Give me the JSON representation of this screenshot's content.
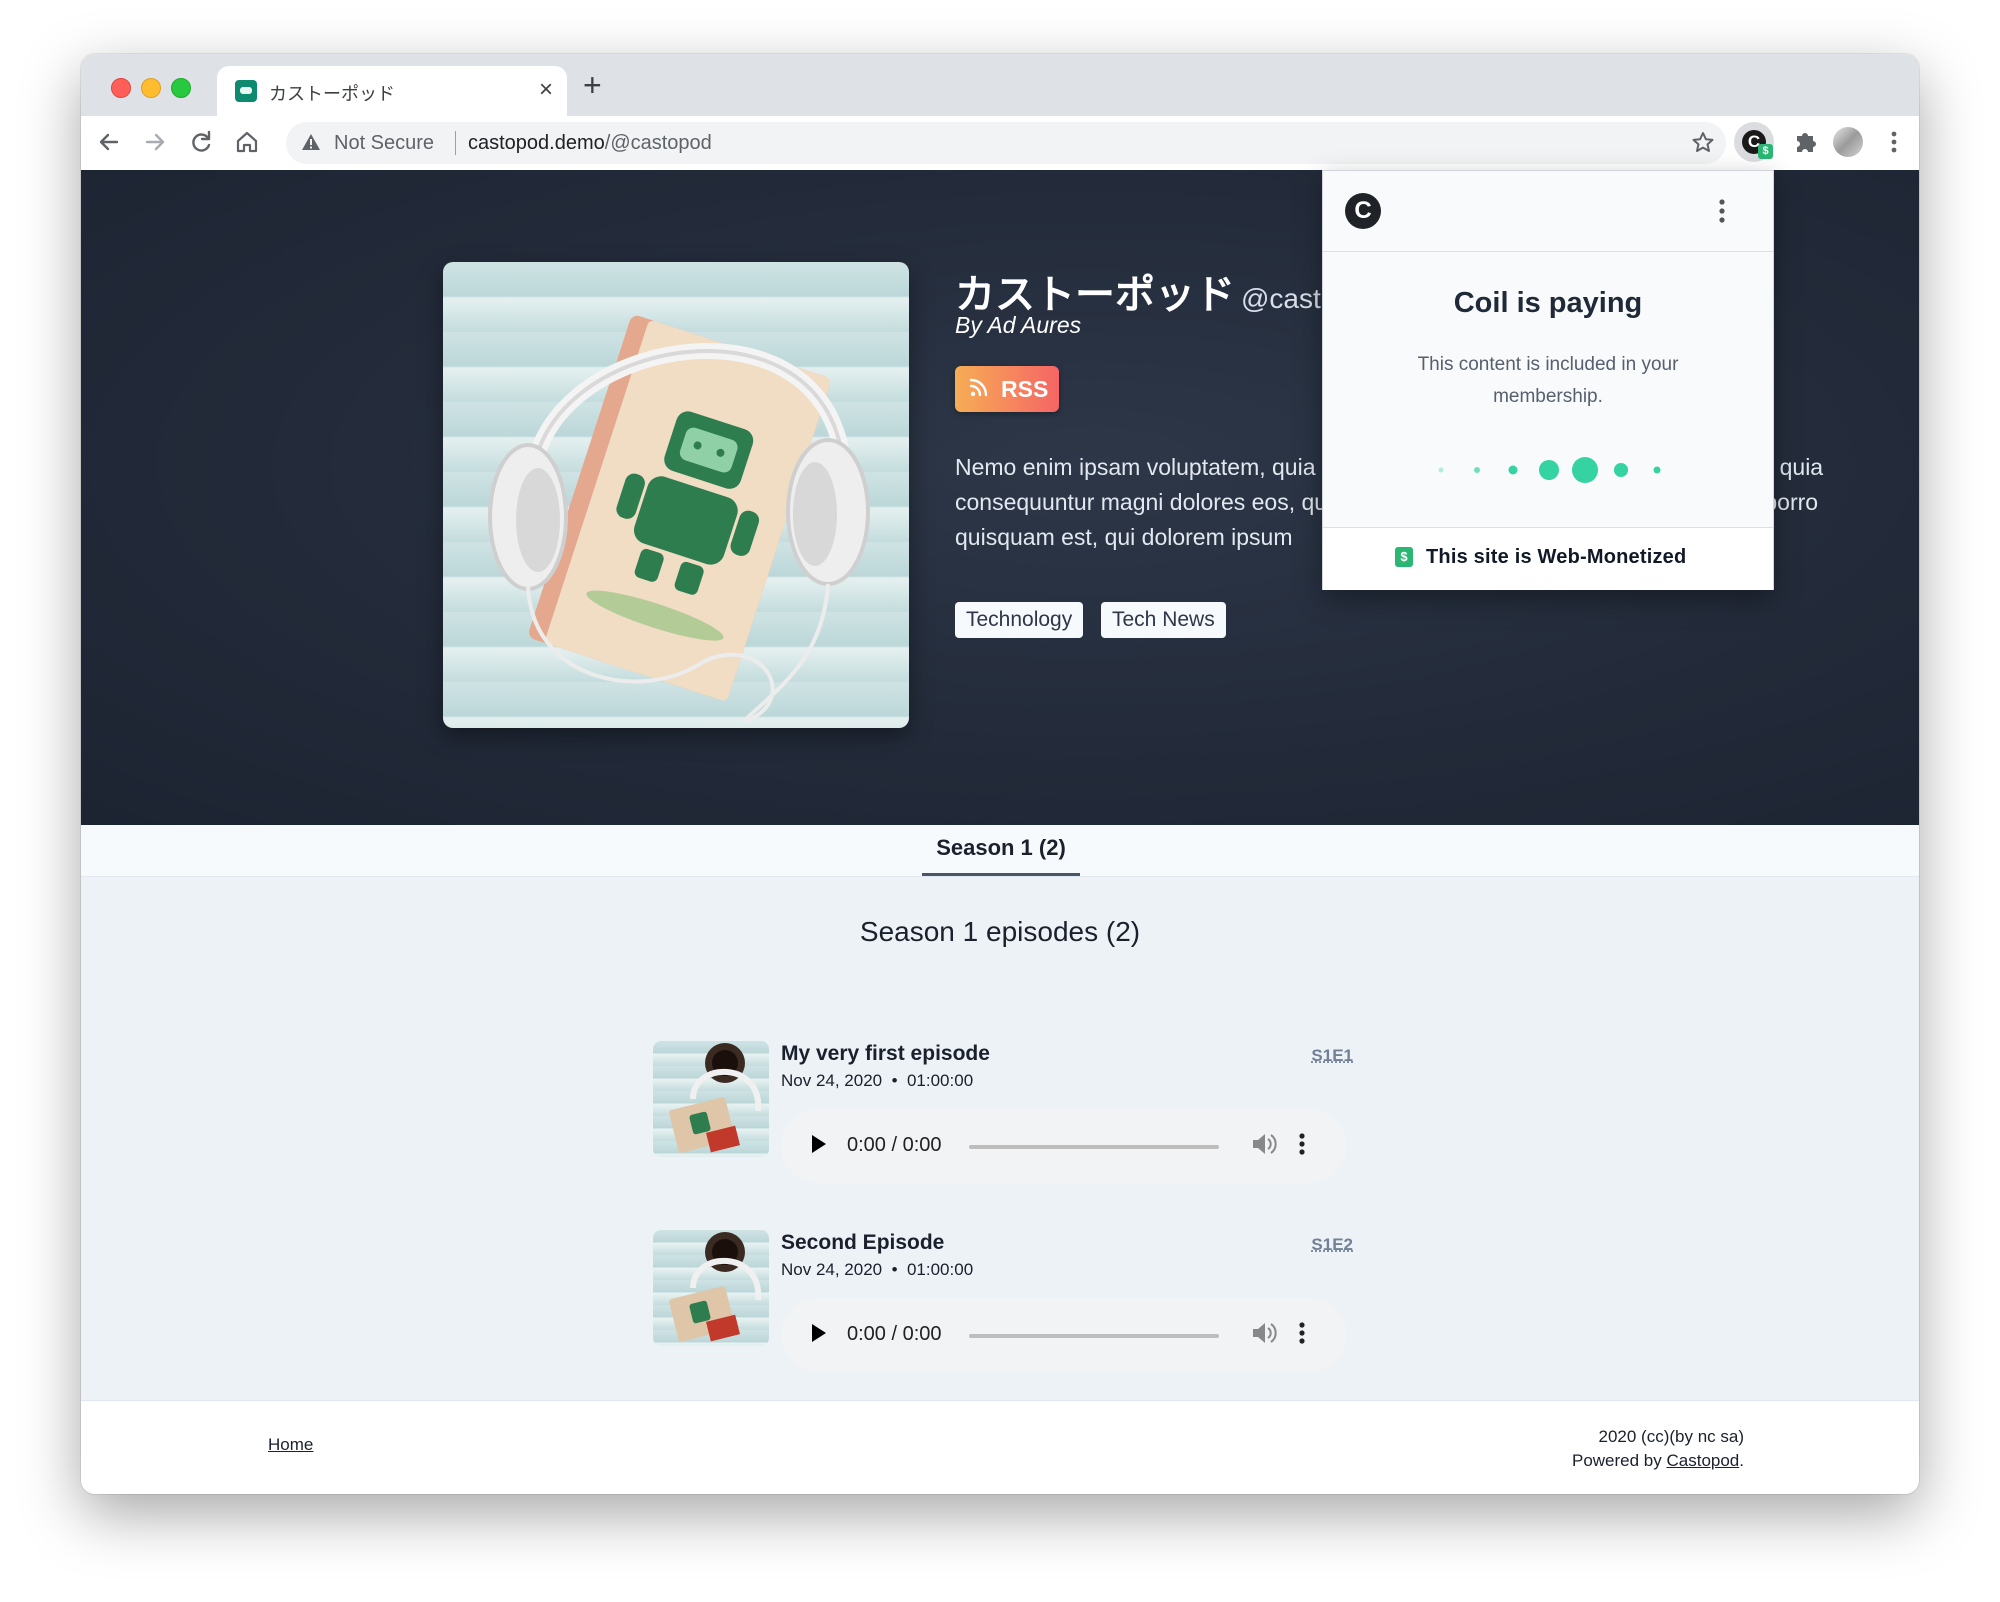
{
  "browser": {
    "tab_title": "カストーポッド",
    "tab_close": "×",
    "new_tab": "+",
    "omnibox": {
      "security_label": "Not Secure",
      "url_host": "castopod.demo",
      "url_path": "/@castopod"
    },
    "icons": [
      "back-icon",
      "forward-icon",
      "reload-icon",
      "home-icon",
      "warning-icon",
      "star-icon",
      "coil-extension-icon",
      "extensions-icon",
      "profile-avatar",
      "chrome-menu-icon"
    ]
  },
  "podcast": {
    "title": "カストーポッド",
    "handle": "@castopod",
    "author": "By Ad Aures",
    "rss_label": "RSS",
    "description": "Nemo enim ipsam voluptatem, quia voluptas sit aspernatur aut odit aut fugit, sed quia consequuntur magni dolores eos, qui ratione voluptatem sequi nesciunt, neque porro quisquam est, qui dolorem ipsum",
    "categories": [
      "Technology",
      "Tech News"
    ]
  },
  "coil_popup": {
    "heading": "Coil is paying",
    "text": "This content is included in your membership.",
    "footer_badge": "$",
    "footer_text": "This site is Web-Monetized"
  },
  "seasons": {
    "active_tab": "Season 1 (2)",
    "heading": "Season 1 episodes (2)"
  },
  "episodes": [
    {
      "title": "My very first episode",
      "date": "Nov 24, 2020",
      "duration": "01:00:00",
      "meta": "Nov 24, 2020  •  01:00:00",
      "number": "S1E1",
      "player_time": "0:00 / 0:00"
    },
    {
      "title": "Second Episode",
      "date": "Nov 24, 2020",
      "duration": "01:00:00",
      "meta": "Nov 24, 2020  •  01:00:00",
      "number": "S1E2",
      "player_time": "0:00 / 0:00"
    }
  ],
  "footer": {
    "home_link": "Home",
    "copyright": "2020 (cc)(by nc sa)",
    "powered_prefix": "Powered by ",
    "powered_link": "Castopod",
    "powered_suffix": "."
  },
  "colors": {
    "hero_bg": "#232b3a",
    "rss_gradient_start": "#f6ad55",
    "rss_gradient_end": "#f56565",
    "coil_green": "#34d3a1",
    "page_bg": "#edf2f7"
  }
}
